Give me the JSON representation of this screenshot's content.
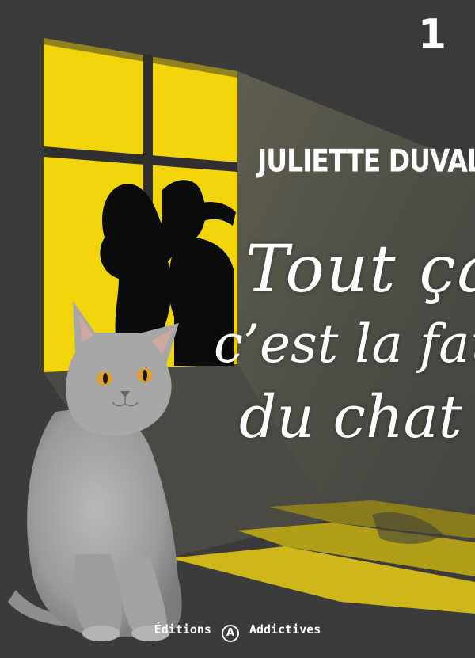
{
  "cover": {
    "volume_number": "1",
    "author": "JULIETTE DUVAL",
    "title_lines": [
      "Tout ça,",
      "c’est la faute",
      "du chat !"
    ],
    "publisher_prefix": "Éditions",
    "publisher_logo_letter": "A",
    "publisher_name": "Addictives"
  },
  "colors": {
    "background": "#3b3b3b",
    "window_light": "#f2d40a",
    "text": "#ffffff"
  },
  "icons": {
    "publisher_logo": "circled-a-logo"
  }
}
